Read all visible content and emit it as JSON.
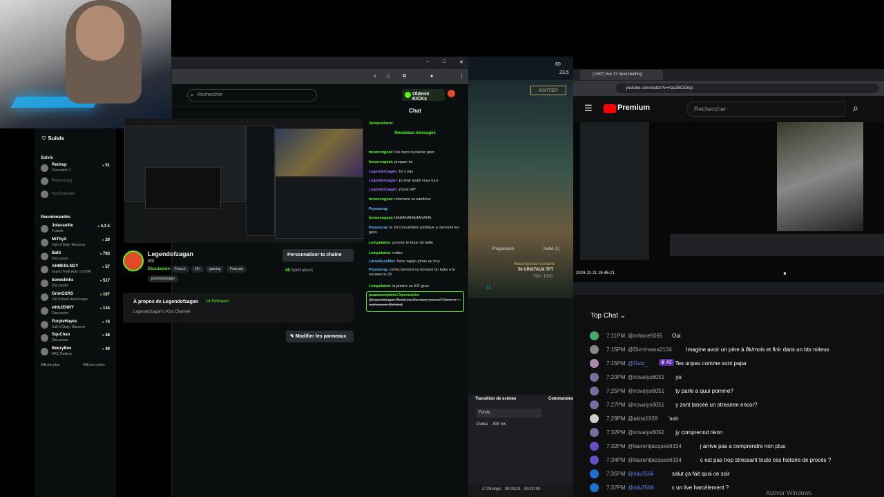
{
  "kick": {
    "search_placeholder": "Rechercher",
    "kicks_button": "Obtenir KICKs",
    "sidebar": {
      "followed": "Suivis",
      "section_followed": "Suivis",
      "section_recommended": "Recommandés",
      "followed_items": [
        {
          "name": "Reckup",
          "game": "Overwatch 2",
          "viewers": "51"
        },
        {
          "name": "Pepsoung",
          "game": "",
          "viewers": ""
        },
        {
          "name": "KurOrientar",
          "game": "",
          "viewers": ""
        }
      ],
      "recommended_items": [
        {
          "name": "Jolavanille",
          "game": "Fortnite",
          "viewers": "4,3 k"
        },
        {
          "name": "MiThyX",
          "game": "Call of Duty: Warzone",
          "viewers": "20"
        },
        {
          "name": "Balti",
          "game": "Discussion",
          "viewers": "783"
        },
        {
          "name": "AHMEDLNDY",
          "game": "Grand Theft Auto V (GTA)",
          "viewers": "57"
        },
        {
          "name": "boneclinks",
          "game": "Discussion",
          "viewers": "517"
        },
        {
          "name": "GrimOSRS",
          "game": "Old School RuneScape",
          "viewers": "167"
        },
        {
          "name": "withJENNY",
          "game": "Discussion",
          "viewers": "134"
        },
        {
          "name": "PurpleHayes",
          "game": "Call of Duty: Warzone",
          "viewers": "74"
        },
        {
          "name": "SquChan",
          "game": "Discussion",
          "viewers": "48"
        },
        {
          "name": "BeezyBee",
          "game": "ARC Raiders",
          "viewers": "40"
        }
      ],
      "show_more": "Afficher plus",
      "show_less": "Afficher moins"
    },
    "channel": {
      "name": "Legendofzagan",
      "subtitle": "Wtf",
      "category": "Discussion",
      "tags": [
        "French",
        "18+",
        "gaming",
        "Francais"
      ],
      "tag_extra": "pommyledegen",
      "customize": "Personnaliser ta chaîne",
      "viewers_count": "48",
      "viewers_label": "Spectateurs",
      "about_title": "À propos de Legendofzagan",
      "followers": "14 Followers",
      "about_desc": "Legendofzagan's Kick Channel",
      "panels_button": "Modifier les panneaux"
    },
    "chat": {
      "title": "Chat",
      "new_messages": "Nouveaux messages",
      "messages": [
        {
          "user": "JackpotAura:",
          "text": "",
          "color": "grn"
        },
        {
          "user": "hooorengoat:",
          "text": "t'es dans la plainte gran",
          "color": "grn"
        },
        {
          "user": "hooorengoat:",
          "text": "prepare toi",
          "color": "grn"
        },
        {
          "user": "Legendofzagan:",
          "text": "txt y pas",
          "color": "pur"
        },
        {
          "user": "Legendofzagan:",
          "text": "j'y était avatn vous tous",
          "color": "pur"
        },
        {
          "user": "Legendofzagan:",
          "text": "j'(suis VIP",
          "color": "pur"
        },
        {
          "user": "hooorengoat:",
          "text": "comment va sandrine",
          "color": "grn"
        },
        {
          "user": "Pepsoung:",
          "text": "",
          "color": "blu"
        },
        {
          "user": "hooorengoat:",
          "text": "HAHAHAHAHAHAHA",
          "color": "grn"
        },
        {
          "user": "Pepsoung:",
          "text": "le 29 consultation juridique a clermont les gens",
          "color": "blu"
        },
        {
          "user": "Lempekatre:",
          "text": "pommy le troue de balle",
          "color": "grn"
        },
        {
          "user": "Lempekatre:",
          "text": "mdrrrr",
          "color": "grn"
        },
        {
          "user": "LinsaSuceMoi:",
          "text": "force zagan johan au trou",
          "color": "blu"
        },
        {
          "user": "Pepsoung:",
          "text": "carlos bernard va envoyer du kaka a la ronziere le 25",
          "color": "blu"
        },
        {
          "user": "Lempekatre:",
          "text": "la platine en IDF gran",
          "color": "grn"
        }
      ],
      "spam_user": "paramountpitchs73mcrmzo3w:",
      "spam_text": "@legendofzagan Would you like many viewers? Come in — nezhna.com (Deleted)"
    }
  },
  "game": {
    "level": "60",
    "rp": "23,5",
    "summoner": "ZaganVsLadder",
    "invite": "INVITER",
    "tab_progress": "Progression",
    "tab_invited": "Invité (1)",
    "reward_title": "Récompense suivante",
    "reward_name": "50 CRISTAUX TFT",
    "reward_progress": "700 / 1000",
    "level_badge": "22"
  },
  "obs": {
    "transitions": "Transition de scènes",
    "commands": "Commandes",
    "fade": "Fondu",
    "duration_label": "Durée",
    "duration_value": "300 ms",
    "bitrate": "2729 kbps",
    "rec_time": "00:09:21",
    "stream_time": "00:00:00"
  },
  "youtube": {
    "tab_title": "(1587) live 72 #justchatting",
    "url": "youtube.com/watch?v=Kaa35CEdcjc",
    "logo": "Premium",
    "region": "FR",
    "search_placeholder": "Rechercher",
    "timestamp": "2024-11-21 18-46-21",
    "top_chat": "Top Chat",
    "messages": [
      {
        "time": "7:11PM",
        "author": "@orhace5065",
        "text": "Oui",
        "mod": false
      },
      {
        "time": "7:15PM",
        "author": "@Diznirvana2124",
        "text": "Imagine avoir un père à 8k/mois et finir dans un bts miteux",
        "mod": false
      },
      {
        "time": "7:15PM",
        "author": "@Guiz_",
        "text": "Tes unpeu comme sont papa",
        "mod": true,
        "badge": "#2"
      },
      {
        "time": "7:20PM",
        "author": "@novalys6051",
        "text": "yo",
        "mod": false
      },
      {
        "time": "7:25PM",
        "author": "@novalys6051",
        "text": "ty parle a quui pomme?",
        "mod": false
      },
      {
        "time": "7:27PM",
        "author": "@novalys6051",
        "text": "y zont lanceé un streamm encor?",
        "mod": false
      },
      {
        "time": "7:29PM",
        "author": "@akira1928",
        "text": "'soir",
        "mod": false
      },
      {
        "time": "7:32PM",
        "author": "@novalys6051",
        "text": "jy comprennd rienn",
        "mod": false
      },
      {
        "time": "7:32PM",
        "author": "@laurentjacques6334",
        "text": "j arrive pas a comprendre non plus",
        "mod": false
      },
      {
        "time": "7:34PM",
        "author": "@laurentjacques6334",
        "text": "c est pas trop stressant toute ces histoire de procés ?",
        "mod": false
      },
      {
        "time": "7:35PM",
        "author": "@oliv3566",
        "text": "salut ça fait quoi ce soir",
        "mod": true
      },
      {
        "time": "7:37PM",
        "author": "@oliv3566",
        "text": "c un live harcèlement ?",
        "mod": true
      }
    ]
  },
  "windows": {
    "activate": "Activer Windows"
  }
}
